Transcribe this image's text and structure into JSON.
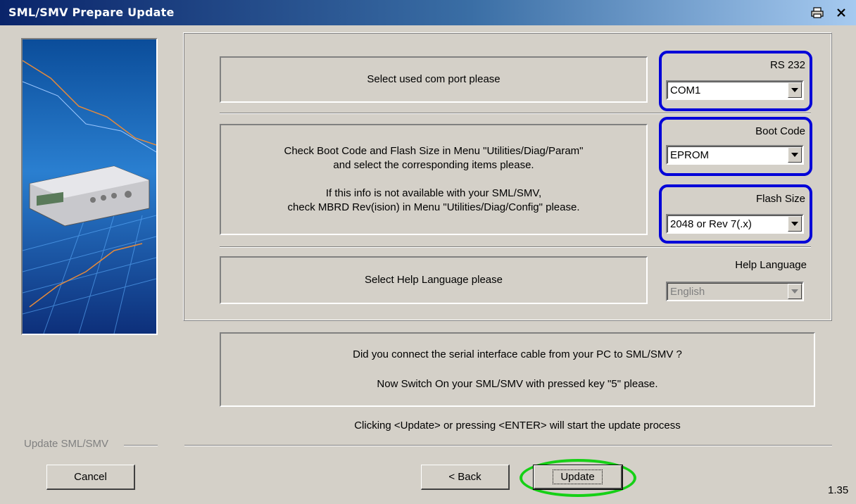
{
  "window": {
    "title": "SML/SMV Prepare Update",
    "version": "1.35"
  },
  "rs232": {
    "label": "RS 232",
    "message": "Select used com port please",
    "selected": "COM1"
  },
  "boot": {
    "label_boot": "Boot Code",
    "selected_boot": "EPROM",
    "label_flash": "Flash Size",
    "selected_flash": "2048 or Rev 7(.x)",
    "message_line1": "Check Boot Code and Flash Size in Menu \"Utilities/Diag/Param\"",
    "message_line2": "and select the corresponding items please.",
    "message_line3": "If this info is not available with your SML/SMV,",
    "message_line4": "check MBRD Rev(ision) in Menu \"Utilities/Diag/Config\" please."
  },
  "help": {
    "label": "Help Language",
    "message": "Select Help Language please",
    "selected": "English"
  },
  "notice": {
    "line1": "Did you connect the serial interface cable from your PC to SML/SMV ?",
    "line2": "Now Switch On your SML/SMV with pressed key \"5\" please."
  },
  "hint": "Clicking <Update> or pressing <ENTER> will start the update process",
  "footer": {
    "group_label": "Update SML/SMV",
    "cancel_label": "Cancel",
    "back_label": "< Back",
    "update_label": "Update"
  },
  "colors": {
    "highlight_blue": "#0000d8",
    "highlight_green": "#16d016",
    "title_bar": "#0a246a"
  },
  "icons": [
    "print-icon",
    "close-icon",
    "chevron-down-icon"
  ]
}
